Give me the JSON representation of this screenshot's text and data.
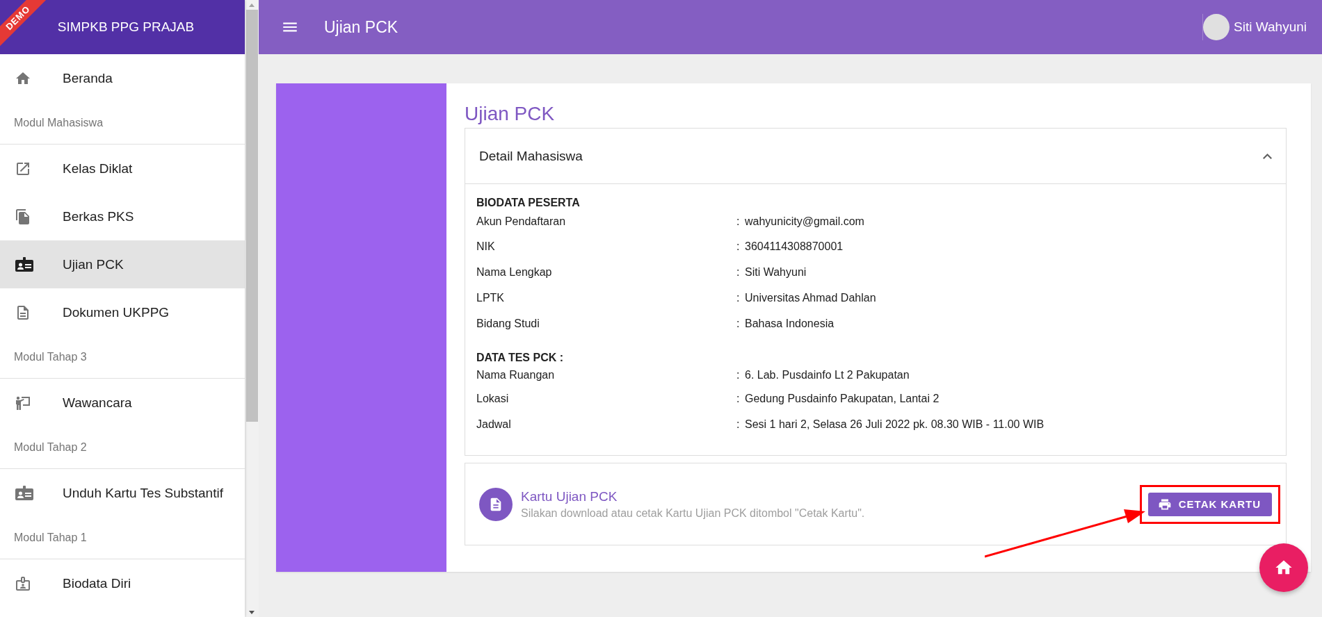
{
  "brand": {
    "ribbon": "DEMO",
    "title": "SIMPKB PPG PRAJAB"
  },
  "sidebar": {
    "items": [
      {
        "kind": "item",
        "label": "Beranda",
        "selected": false
      },
      {
        "kind": "section",
        "label": "Modul Mahasiswa"
      },
      {
        "kind": "item",
        "label": "Kelas Diklat",
        "selected": false
      },
      {
        "kind": "item",
        "label": "Berkas PKS",
        "selected": false
      },
      {
        "kind": "item",
        "label": "Ujian PCK",
        "selected": true
      },
      {
        "kind": "item",
        "label": "Dokumen UKPPG",
        "selected": false
      },
      {
        "kind": "section",
        "label": "Modul Tahap 3"
      },
      {
        "kind": "item",
        "label": "Wawancara",
        "selected": false
      },
      {
        "kind": "section",
        "label": "Modul Tahap 2"
      },
      {
        "kind": "item",
        "label": "Unduh Kartu Tes Substantif",
        "selected": false
      },
      {
        "kind": "section",
        "label": "Modul Tahap 1"
      },
      {
        "kind": "item",
        "label": "Biodata Diri",
        "selected": false
      }
    ]
  },
  "header": {
    "title": "Ujian PCK",
    "user": "Siti Wahyuni"
  },
  "page": {
    "title": "Ujian PCK",
    "panel": {
      "title": "Detail Mahasiswa",
      "expanded": true,
      "groups": [
        {
          "heading": "BIODATA PESERTA",
          "rows": [
            {
              "label": "Akun Pendaftaran",
              "colon": ":",
              "value": "wahyunicity@gmail.com"
            },
            {
              "label": "NIK",
              "colon": ":",
              "value": "3604114308870001"
            },
            {
              "label": "Nama Lengkap",
              "colon": ":",
              "value": "Siti Wahyuni"
            },
            {
              "label": "LPTK",
              "colon": ":",
              "value": "Universitas Ahmad Dahlan"
            },
            {
              "label": "Bidang Studi",
              "colon": ":",
              "value": "Bahasa Indonesia"
            }
          ]
        },
        {
          "heading": "DATA TES PCK :",
          "rows": [
            {
              "label": "Nama Ruangan",
              "colon": ":",
              "value": "6. Lab. Pusdainfo Lt 2 Pakupatan"
            },
            {
              "label": "Lokasi",
              "colon": ":",
              "value": "Gedung Pusdainfo Pakupatan, Lantai 2"
            },
            {
              "label": "Jadwal",
              "colon": ":",
              "value": "Sesi 1 hari 2, Selasa 26 Juli 2022 pk. 08.30 WIB - 11.00 WIB"
            }
          ]
        }
      ]
    },
    "card": {
      "title": "Kartu Ujian PCK",
      "text": "Silakan download atau cetak Kartu Ujian PCK ditombol \"Cetak Kartu\".",
      "button": "CETAK KARTU"
    }
  }
}
